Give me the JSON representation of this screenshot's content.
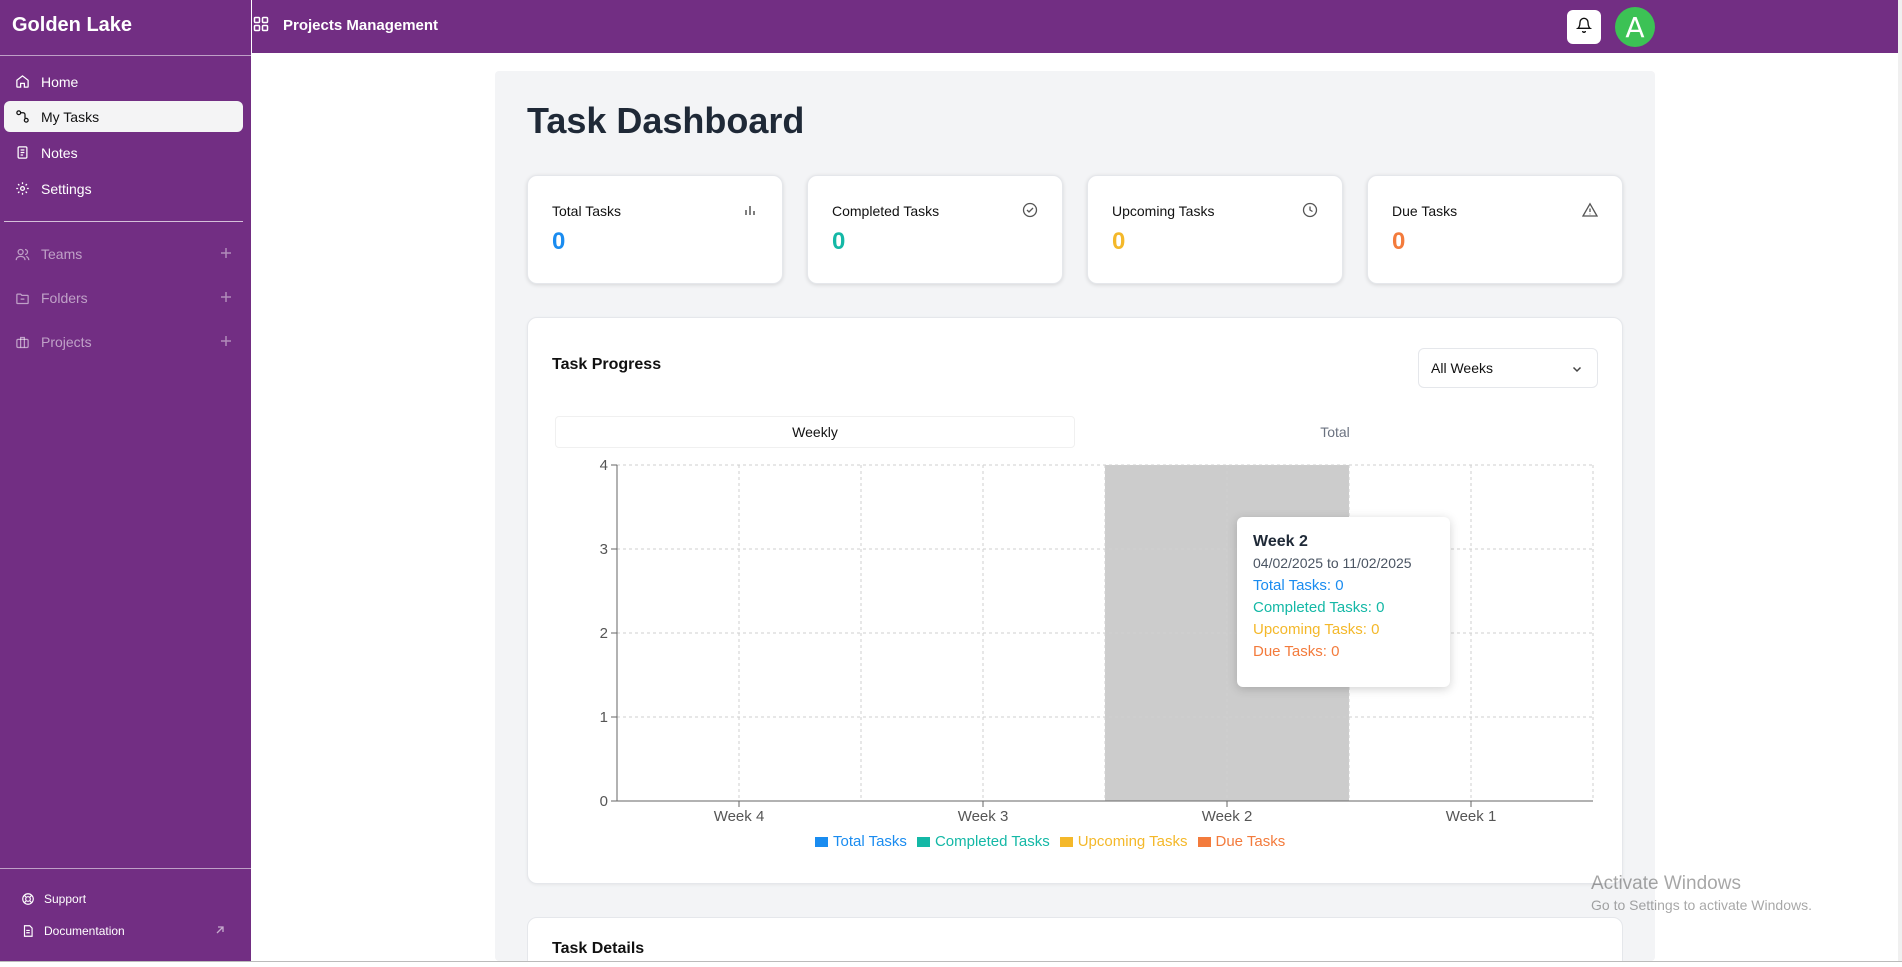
{
  "sidebar": {
    "brand": "Golden Lake",
    "nav": [
      {
        "label": "Home",
        "icon": "home-icon"
      },
      {
        "label": "My Tasks",
        "icon": "tasks-icon"
      },
      {
        "label": "Notes",
        "icon": "notes-icon"
      },
      {
        "label": "Settings",
        "icon": "gear-icon"
      }
    ],
    "groups": [
      {
        "label": "Teams",
        "icon": "users-icon"
      },
      {
        "label": "Folders",
        "icon": "folder-icon"
      },
      {
        "label": "Projects",
        "icon": "briefcase-icon"
      }
    ],
    "bottom": [
      {
        "label": "Support",
        "icon": "lifebuoy-icon"
      },
      {
        "label": "Documentation",
        "icon": "document-icon"
      }
    ]
  },
  "header": {
    "app_title": "Projects Management",
    "avatar_initial": "A"
  },
  "page": {
    "title": "Task Dashboard"
  },
  "stats": [
    {
      "label": "Total Tasks",
      "value": "0",
      "color": "#1a8cf0",
      "icon": "bar-chart-icon"
    },
    {
      "label": "Completed Tasks",
      "value": "0",
      "color": "#14b8a6",
      "icon": "check-circle-icon"
    },
    {
      "label": "Upcoming Tasks",
      "value": "0",
      "color": "#f4b82a",
      "icon": "clock-icon"
    },
    {
      "label": "Due Tasks",
      "value": "0",
      "color": "#f37b3c",
      "icon": "warning-icon"
    }
  ],
  "progress": {
    "title": "Task Progress",
    "select_value": "All Weeks",
    "tabs": [
      "Weekly",
      "Total"
    ]
  },
  "tooltip": {
    "title": "Week 2",
    "range": "04/02/2025 to 11/02/2025",
    "lines": [
      "Total Tasks: 0",
      "Completed Tasks: 0",
      "Upcoming Tasks: 0",
      "Due Tasks: 0"
    ]
  },
  "details": {
    "title": "Task Details"
  },
  "watermark": {
    "line1": "Activate Windows",
    "line2": "Go to Settings to activate Windows."
  },
  "chart_data": {
    "type": "bar",
    "categories": [
      "Week 4",
      "Week 3",
      "Week 2",
      "Week 1"
    ],
    "series": [
      {
        "name": "Total Tasks",
        "color": "#1a8cf0",
        "values": [
          0,
          0,
          0,
          0
        ]
      },
      {
        "name": "Completed Tasks",
        "color": "#14b8a6",
        "values": [
          0,
          0,
          0,
          0
        ]
      },
      {
        "name": "Upcoming Tasks",
        "color": "#f4b82a",
        "values": [
          0,
          0,
          0,
          0
        ]
      },
      {
        "name": "Due Tasks",
        "color": "#f37b3c",
        "values": [
          0,
          0,
          0,
          0
        ]
      }
    ],
    "ylim": [
      0,
      4
    ],
    "yticks": [
      0,
      1,
      2,
      3,
      4
    ],
    "grid": true,
    "highlighted_category": "Week 2",
    "legend": "bottom"
  }
}
